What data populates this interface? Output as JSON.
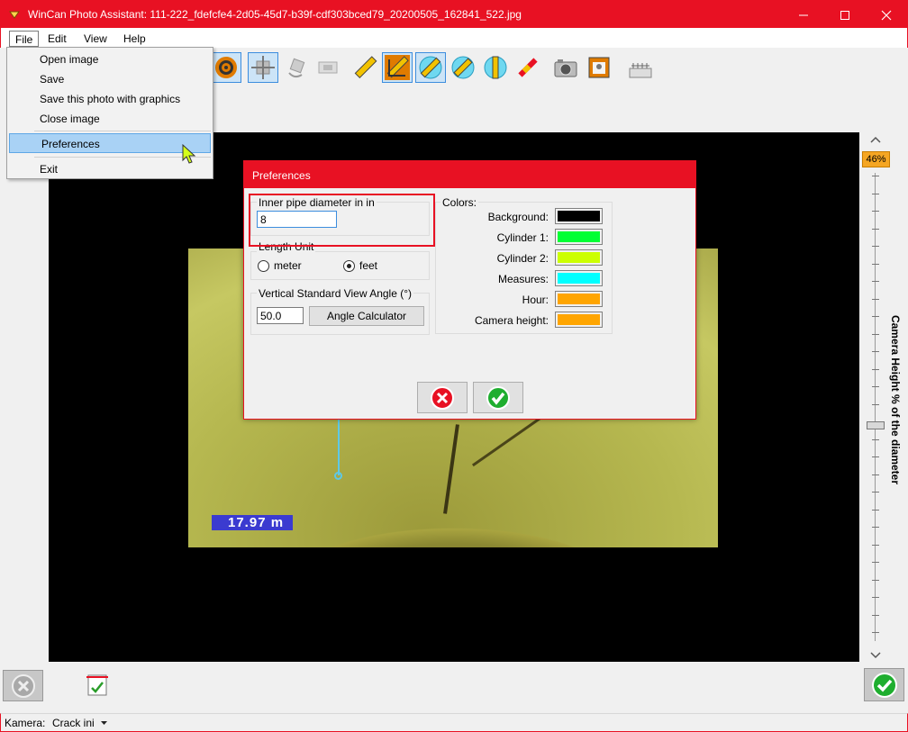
{
  "window": {
    "title": "WinCan Photo Assistant: 111-222_fdefcfe4-2d05-45d7-b39f-cdf303bced79_20200505_162841_522.jpg"
  },
  "menubar": {
    "items": [
      "File",
      "Edit",
      "View",
      "Help"
    ]
  },
  "file_menu": {
    "items": [
      "Open image",
      "Save",
      "Save this photo with graphics",
      "Close image",
      "Preferences",
      "Exit"
    ],
    "highlighted": "Preferences"
  },
  "photo": {
    "distance_label": "17.97 m"
  },
  "slider": {
    "percent": "46%",
    "label": "Camera Height % of the diameter",
    "value_fraction": 0.46
  },
  "preferences": {
    "title": "Preferences",
    "diameter_label": "Inner pipe diameter in in",
    "diameter_value": "8",
    "length_unit_label": "Length Unit",
    "unit_meter": "meter",
    "unit_feet": "feet",
    "selected_unit": "feet",
    "angle_label": "Vertical Standard View Angle (°)",
    "angle_value": "50.0",
    "angle_calc_button": "Angle Calculator",
    "colors_label": "Colors:",
    "colors": [
      {
        "label": "Background:",
        "color": "#000000"
      },
      {
        "label": "Cylinder 1:",
        "color": "#00ff33"
      },
      {
        "label": "Cylinder 2:",
        "color": "#ccff00"
      },
      {
        "label": "Measures:",
        "color": "#00ffff"
      },
      {
        "label": "Hour:",
        "color": "#ffa500"
      },
      {
        "label": "Camera height:",
        "color": "#ffa500"
      }
    ]
  },
  "statusbar": {
    "camera_label": "Kamera:",
    "camera_value": "Crack ini"
  },
  "accent": "#e81123"
}
